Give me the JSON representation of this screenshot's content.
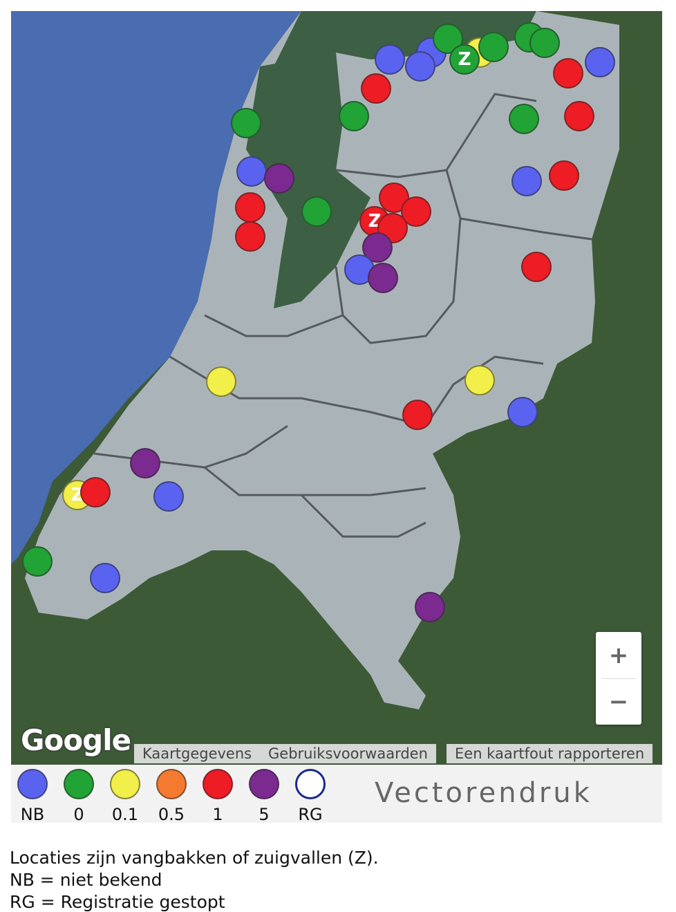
{
  "map": {
    "colors": {
      "sea": "#4a6cb0",
      "land_nl": "#aab4b8",
      "land_foreign": "#3d5a37",
      "wadden": "#3d5f43",
      "border": "#555a5e"
    },
    "markers": [
      {
        "color": "#5a63f0",
        "label": ""
      },
      {
        "color": "#5a63f0",
        "label": ""
      },
      {
        "color": "#5a63f0",
        "label": ""
      },
      {
        "color": "#21a336",
        "label": ""
      },
      {
        "color": "#21a336",
        "label": ""
      },
      {
        "color": "#f2ee4a",
        "label": ""
      },
      {
        "color": "#21a336",
        "label": "Z"
      },
      {
        "color": "#21a336",
        "label": ""
      },
      {
        "color": "#21a336",
        "label": ""
      },
      {
        "color": "#5a63f0",
        "label": ""
      },
      {
        "color": "#ee1c24",
        "label": ""
      },
      {
        "color": "#ee1c24",
        "label": ""
      },
      {
        "color": "#21a336",
        "label": ""
      },
      {
        "color": "#21a336",
        "label": ""
      },
      {
        "color": "#ee1c24",
        "label": ""
      },
      {
        "color": "#21a336",
        "label": ""
      },
      {
        "color": "#5a63f0",
        "label": ""
      },
      {
        "color": "#7b2a8f",
        "label": ""
      },
      {
        "color": "#5a63f0",
        "label": ""
      },
      {
        "color": "#ee1c24",
        "label": ""
      },
      {
        "color": "#ee1c24",
        "label": ""
      },
      {
        "color": "#ee1c24",
        "label": ""
      },
      {
        "color": "#21a336",
        "label": ""
      },
      {
        "color": "#ee1c24",
        "label": ""
      },
      {
        "color": "#ee1c24",
        "label": ""
      },
      {
        "color": "#ee1c24",
        "label": "Z"
      },
      {
        "color": "#ee1c24",
        "label": ""
      },
      {
        "color": "#7b2a8f",
        "label": ""
      },
      {
        "color": "#5a63f0",
        "label": ""
      },
      {
        "color": "#7b2a8f",
        "label": ""
      },
      {
        "color": "#ee1c24",
        "label": ""
      },
      {
        "color": "#f2ee4a",
        "label": ""
      },
      {
        "color": "#f2ee4a",
        "label": ""
      },
      {
        "color": "#ee1c24",
        "label": ""
      },
      {
        "color": "#5a63f0",
        "label": ""
      },
      {
        "color": "#7b2a8f",
        "label": ""
      },
      {
        "color": "#f2ee4a",
        "label": "Z"
      },
      {
        "color": "#ee1c24",
        "label": ""
      },
      {
        "color": "#5a63f0",
        "label": ""
      },
      {
        "color": "#21a336",
        "label": ""
      },
      {
        "color": "#5a63f0",
        "label": ""
      },
      {
        "color": "#7b2a8f",
        "label": ""
      }
    ],
    "zoom_in_label": "+",
    "zoom_out_label": "−",
    "google_logo": "Google",
    "attribution": [
      "Kaartgegevens",
      "Gebruiksvoorwaarden",
      "Een kaartfout rapporteren"
    ]
  },
  "legend": {
    "items": [
      {
        "label": "NB",
        "color": "#5a63f0",
        "fill": true
      },
      {
        "label": "0",
        "color": "#21a336",
        "fill": true
      },
      {
        "label": "0.1",
        "color": "#f2ee4a",
        "fill": true
      },
      {
        "label": "0.5",
        "color": "#f47a30",
        "fill": true
      },
      {
        "label": "1",
        "color": "#ee1c24",
        "fill": true
      },
      {
        "label": "5",
        "color": "#7b2a8f",
        "fill": true
      },
      {
        "label": "RG",
        "color": "#1a2a8a",
        "fill": false
      }
    ],
    "title": "Vectorendruk"
  },
  "notes": [
    "Locaties zijn vangbakken of zuigvallen (Z).",
    "NB = niet bekend",
    "RG = Registratie gestopt"
  ]
}
